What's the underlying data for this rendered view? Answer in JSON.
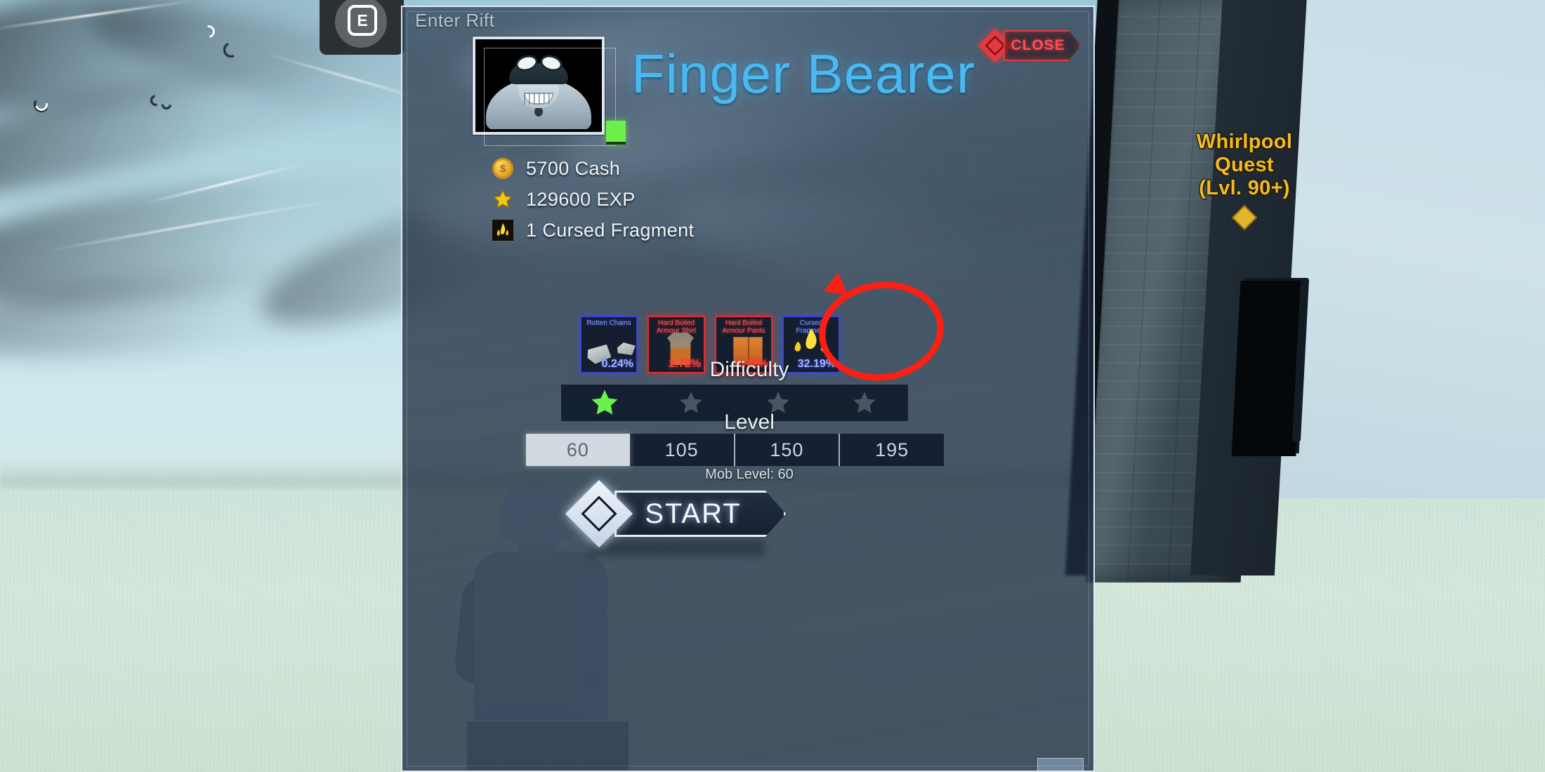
{
  "world": {
    "key_prompt": {
      "key": "E",
      "name": "interact-key-prompt"
    },
    "quest_sign": {
      "line1": "Whirlpool",
      "line2": "Quest",
      "line3": "(Lvl. 90+)",
      "color": "#f0bb2b"
    }
  },
  "panel": {
    "title": "Enter Rift",
    "close_label": "CLOSE",
    "boss_name": "Finger Bearer",
    "accent_color": "#49b9f0",
    "close_color": "#e33a3f",
    "rewards": [
      {
        "icon": "coin-icon",
        "text": "5700 Cash"
      },
      {
        "icon": "star-icon",
        "text": "129600 EXP"
      },
      {
        "icon": "cursed-fragment-icon",
        "text": "1 Cursed Fragment"
      }
    ],
    "drops": [
      {
        "name": "Rotten Chains",
        "chance": "0.24%",
        "rarity": "blue",
        "art": "chains"
      },
      {
        "name": "Hard Boiled Armour Shirt",
        "chance": "2.72%",
        "rarity": "red",
        "art": "shirt"
      },
      {
        "name": "Hard Boiled Armour Pants",
        "chance": "2.72%",
        "rarity": "red",
        "art": "pants"
      },
      {
        "name": "Cursed Fragment",
        "chance": "32.19%",
        "rarity": "blue",
        "art": "flame",
        "highlighted": true
      }
    ],
    "difficulty": {
      "label": "Difficulty",
      "total_stars": 4,
      "filled_stars": 1,
      "filled_color": "#6cf04a",
      "empty_color": "#4a5462"
    },
    "level": {
      "label": "Level",
      "options": [
        "60",
        "105",
        "150",
        "195"
      ],
      "selected": "60",
      "mob_level_text": "Mob Level: 60"
    },
    "start_label": "START"
  }
}
